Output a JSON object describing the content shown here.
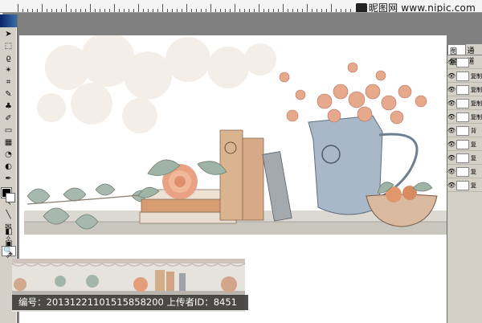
{
  "app": {
    "watermark_text": "昵图网 www.nipic.com"
  },
  "toolbox": {
    "tools": [
      {
        "icon": "move-icon",
        "glyph": "➤"
      },
      {
        "icon": "marquee-icon",
        "glyph": "⬚"
      },
      {
        "icon": "lasso-icon",
        "glyph": "ϱ"
      },
      {
        "icon": "magic-wand-icon",
        "glyph": "✴"
      },
      {
        "icon": "crop-icon",
        "glyph": "⌗"
      },
      {
        "icon": "brush-icon",
        "glyph": "✎"
      },
      {
        "icon": "stamp-icon",
        "glyph": "♣"
      },
      {
        "icon": "history-brush-icon",
        "glyph": "✐"
      },
      {
        "icon": "eraser-icon",
        "glyph": "▭"
      },
      {
        "icon": "gradient-icon",
        "glyph": "▦"
      },
      {
        "icon": "blur-icon",
        "glyph": "◔"
      },
      {
        "icon": "dodge-icon",
        "glyph": "◐"
      },
      {
        "icon": "pen-icon",
        "glyph": "✒"
      },
      {
        "icon": "type-icon",
        "glyph": "T"
      },
      {
        "icon": "path-select-icon",
        "glyph": "↖"
      },
      {
        "icon": "shape-icon",
        "glyph": "╲"
      },
      {
        "icon": "notes-icon",
        "glyph": "✉"
      },
      {
        "icon": "eyedropper-icon",
        "glyph": "✧"
      },
      {
        "icon": "zoom-icon",
        "glyph": "🔍"
      }
    ],
    "bottom_tools": [
      {
        "icon": "quickmask-icon",
        "glyph": "◧"
      },
      {
        "icon": "screenmode-icon",
        "glyph": "▣"
      },
      {
        "icon": "jump-icon",
        "glyph": "⇗"
      }
    ]
  },
  "layers_panel": {
    "tabs": [
      "图层",
      "通道"
    ],
    "layers": [
      "",
      "复制",
      "复制",
      "复制",
      "复制",
      "背",
      "复",
      "复",
      "复",
      "复"
    ]
  },
  "caption": {
    "text": "编号：20131221101515858200 上传者ID：8451"
  },
  "colors": {
    "canvas": "#ffffff",
    "shelf": "#c9c6bd",
    "rose": "#e8a283",
    "book_orange": "#d89c72",
    "pitcher": "#a8b8c8",
    "leaf": "#8fa69b"
  }
}
